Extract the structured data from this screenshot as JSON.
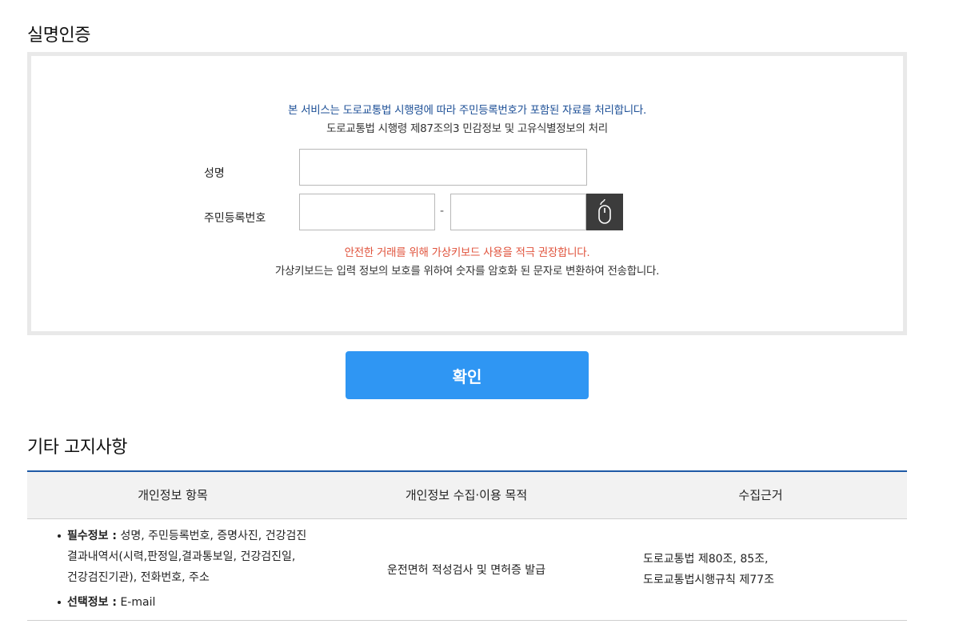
{
  "auth": {
    "title": "실명인증",
    "notice_line1": "본 서비스는 도로교통법 시행령에 따라 주민등록번호가 포함된 자료를 처리합니다.",
    "notice_line2": "도로교통법 시행령 제87조의3 민감정보 및 고유식별정보의 처리",
    "name_label": "성명",
    "name_value": "",
    "rrn_label": "주민등록번호",
    "rrn_front_value": "",
    "rrn_back_value": "",
    "rrn_separator": "-",
    "vk_icon": "mouse-icon",
    "vk_warning": "안전한 거래를 위해 가상키보드 사용을 적극 권장합니다.",
    "vk_description": "가상키보드는 입력 정보의 보호를 위하여 숫자를 암호화 된 문자로 변환하여 전송합니다.",
    "confirm_label": "확인"
  },
  "notice": {
    "title": "기타 고지사항",
    "headers": [
      "개인정보 항목",
      "개인정보 수집·이용 목적",
      "수집근거"
    ],
    "required_label": "필수정보 :",
    "required_line1": " 성명, 주민등록번호, 증명사진, 건강검진",
    "required_line2": "결과내역서(시력,판정일,결과통보일, 건강검진일,",
    "required_line3": "건강검진기관), 전화번호, 주소",
    "optional_label": "선택정보 :",
    "optional_value": " E-mail",
    "purpose": "운전면허 적성검사 및 면허증 발급",
    "basis_line1": "도로교통법 제80조, 85조,",
    "basis_line2": "도로교통법시행규칙 제77조"
  },
  "colors": {
    "accent_blue": "#2f96f3",
    "notice_blue": "#1c4f96",
    "warning_red": "#e0533c",
    "table_border": "#1f5aa6"
  }
}
